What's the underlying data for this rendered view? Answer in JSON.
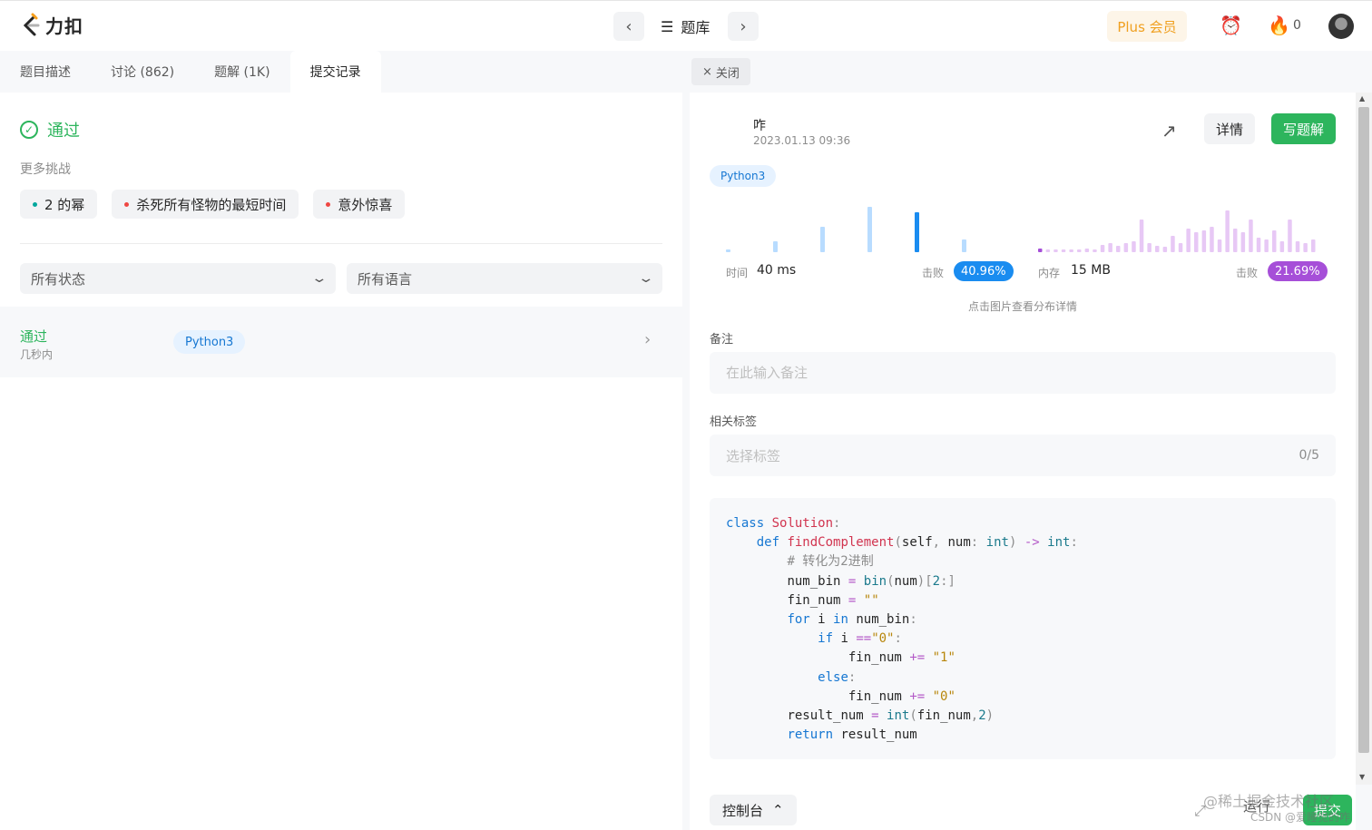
{
  "header": {
    "logo_text": "力扣",
    "problemset_label": "题库",
    "plus_label": "Plus 会员",
    "streak_count": "0"
  },
  "left": {
    "tabs": [
      "题目描述",
      "讨论 (862)",
      "题解 (1K)",
      "提交记录"
    ],
    "active_tab": "提交记录",
    "status": "通过",
    "more_label": "更多挑战",
    "challenges": [
      {
        "label": "2 的幂",
        "color": "#00a79d"
      },
      {
        "label": "杀死所有怪物的最短时间",
        "color": "#ef4743"
      },
      {
        "label": "意外惊喜",
        "color": "#ef4743"
      }
    ],
    "filters": {
      "status": "所有状态",
      "language": "所有语言"
    },
    "submissions": [
      {
        "status": "通过",
        "time": "几秒内",
        "language": "Python3"
      }
    ]
  },
  "right": {
    "close_label": "关闭",
    "user_name": "咋",
    "submit_time": "2023.01.13 09:36",
    "detail_label": "详情",
    "write_solution_label": "写题解",
    "language": "Python3",
    "runtime": {
      "label": "时间",
      "value": "40 ms",
      "beat_label": "击败",
      "beat_value": "40.96%",
      "color": "#1a8cf0"
    },
    "memory": {
      "label": "内存",
      "value": "15 MB",
      "beat_label": "击败",
      "beat_value": "21.69%",
      "color": "#a64fd8"
    },
    "chart_hint": "点击图片查看分布详情",
    "notes_label": "备注",
    "notes_placeholder": "在此输入备注",
    "tags_label": "相关标签",
    "tags_placeholder": "选择标签",
    "tags_count": "0/5",
    "code_lines": [
      "class Solution:",
      "    def findComplement(self, num: int) -> int:",
      "        # 转化为2进制",
      "        num_bin = bin(num)[2:]",
      "        fin_num = \"\"",
      "        for i in num_bin:",
      "            if i ==\"0\":",
      "                fin_num += \"1\"",
      "            else:",
      "                fin_num += \"0\"",
      "        result_num = int(fin_num,2)",
      "        return result_num"
    ]
  },
  "bottom": {
    "console_label": "控制台",
    "run_label": "运行",
    "submit_label": "提交",
    "watermark": "@稀土掘金技术社区",
    "watermark2": "CSDN @爱睡觉的咋"
  }
}
